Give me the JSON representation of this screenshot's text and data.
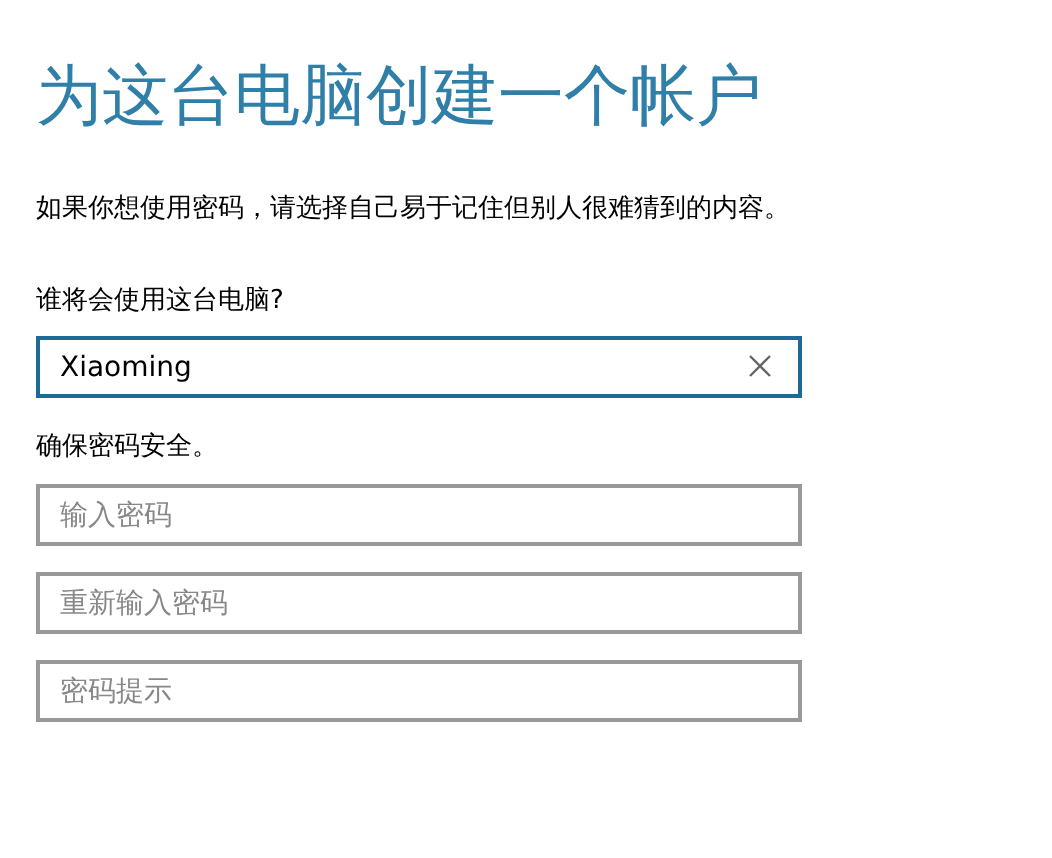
{
  "title": "为这台电脑创建一个帐户",
  "description": "如果你想使用密码，请选择自己易于记住但别人很难猜到的内容。",
  "user_section": {
    "label": "谁将会使用这台电脑?",
    "field": {
      "value": "Xiaoming",
      "focused": true
    }
  },
  "password_section": {
    "label": "确保密码安全。",
    "fields": [
      {
        "placeholder": "输入密码",
        "focused": false
      },
      {
        "placeholder": "重新输入密码",
        "focused": false
      },
      {
        "placeholder": "密码提示",
        "focused": false
      }
    ]
  }
}
